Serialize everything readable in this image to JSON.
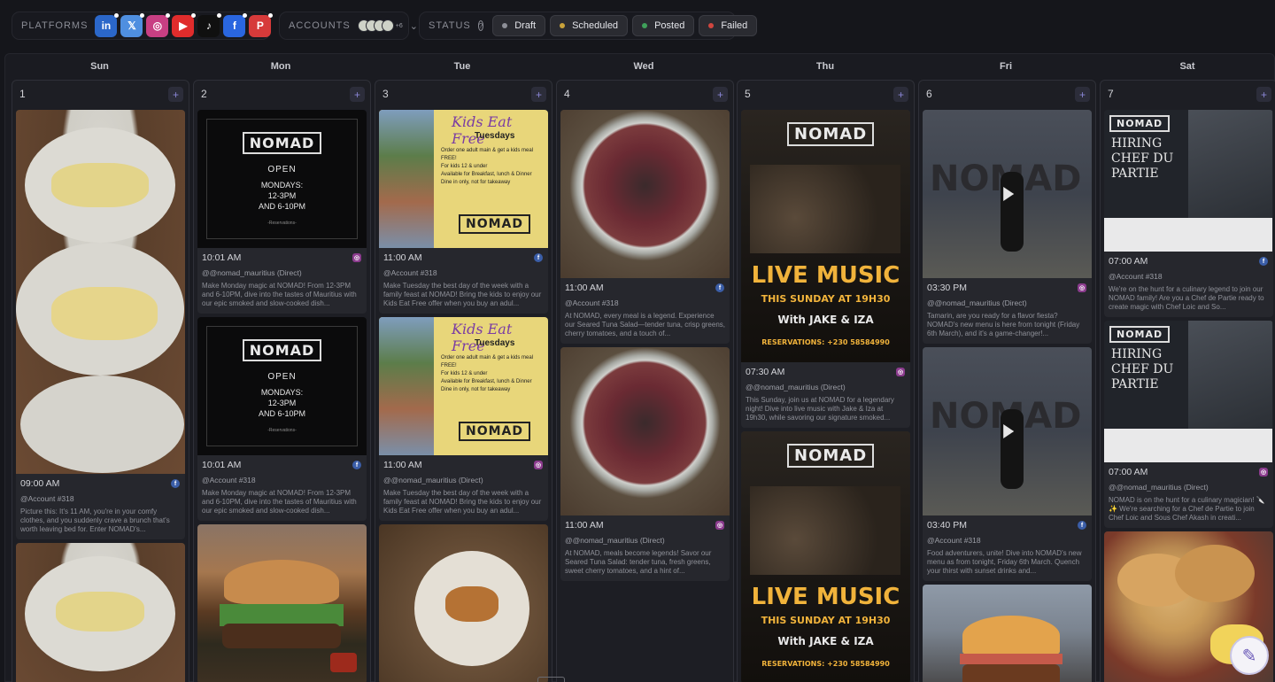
{
  "filters": {
    "platforms_label": "PLATFORMS",
    "platforms": [
      {
        "name": "linkedin",
        "icon": "linkedin-icon",
        "glyph": "in",
        "color": "#2b67c9"
      },
      {
        "name": "x",
        "icon": "x-icon",
        "glyph": "𝕏",
        "color": "#4f8fe0"
      },
      {
        "name": "instagram",
        "icon": "instagram-icon",
        "glyph": "◎",
        "color": "#c83f83"
      },
      {
        "name": "youtube",
        "icon": "youtube-icon",
        "glyph": "▶",
        "color": "#e02c2c"
      },
      {
        "name": "tiktok",
        "icon": "tiktok-icon",
        "glyph": "♪",
        "color": "#101010"
      },
      {
        "name": "facebook",
        "icon": "facebook-icon",
        "glyph": "f",
        "color": "#2a66e0"
      },
      {
        "name": "pinterest",
        "icon": "pinterest-icon",
        "glyph": "P",
        "color": "#d63a3a"
      }
    ],
    "accounts_label": "ACCOUNTS",
    "accounts_more": "+6",
    "status_label": "STATUS",
    "statuses": [
      {
        "label": "Draft",
        "color": "#8d8f97"
      },
      {
        "label": "Scheduled",
        "color": "#c9a23a"
      },
      {
        "label": "Posted",
        "color": "#3fa05a"
      },
      {
        "label": "Failed",
        "color": "#d0463f"
      }
    ]
  },
  "days": [
    {
      "name": "Sun",
      "num": "1"
    },
    {
      "name": "Mon",
      "num": "2"
    },
    {
      "name": "Tue",
      "num": "3"
    },
    {
      "name": "Wed",
      "num": "4"
    },
    {
      "name": "Thu",
      "num": "5"
    },
    {
      "name": "Fri",
      "num": "6"
    },
    {
      "name": "Sat",
      "num": "7"
    }
  ],
  "posts": {
    "sun_1": {
      "time": "09:00 AM",
      "network": "facebook",
      "account": "@Account #318",
      "caption": "Picture this: It's 11 AM, you're in your comfy clothes, and you suddenly crave a brunch that's worth leaving bed for. Enter NOMAD's..."
    },
    "mon_1": {
      "time": "10:01 AM",
      "network": "instagram",
      "account": "@@nomad_mauritius (Direct)",
      "caption": "Make Monday magic at NOMAD! From 12-3PM and 6-10PM, dive into the tastes of Mauritius with our epic smoked and slow-cooked dish..."
    },
    "mon_2": {
      "time": "10:01 AM",
      "network": "facebook",
      "account": "@Account #318",
      "caption": "Make Monday magic at NOMAD! From 12-3PM and 6-10PM, dive into the tastes of Mauritius with our epic smoked and slow-cooked dish..."
    },
    "tue_1": {
      "time": "11:00 AM",
      "network": "facebook",
      "account": "@Account #318",
      "caption": "Make Tuesday the best day of the week with a family feast at NOMAD! Bring the kids to enjoy our Kids Eat Free offer when you buy an adul..."
    },
    "tue_2": {
      "time": "11:00 AM",
      "network": "instagram",
      "account": "@@nomad_mauritius (Direct)",
      "caption": "Make Tuesday the best day of the week with a family feast at NOMAD! Bring the kids to enjoy our Kids Eat Free offer when you buy an adul..."
    },
    "wed_1": {
      "time": "11:00 AM",
      "network": "facebook",
      "account": "@Account #318",
      "caption": "At NOMAD, every meal is a legend. Experience our Seared Tuna Salad—tender tuna, crisp greens, cherry tomatoes, and a touch of..."
    },
    "wed_2": {
      "time": "11:00 AM",
      "network": "instagram",
      "account": "@@nomad_mauritius (Direct)",
      "caption": "At NOMAD, meals become legends! Savor our Seared Tuna Salad: tender tuna, fresh greens, sweet cherry tomatoes, and a hint of..."
    },
    "thu_1": {
      "time": "07:30 AM",
      "network": "instagram",
      "account": "@@nomad_mauritius (Direct)",
      "caption": "This Sunday, join us at NOMAD for a legendary night! Dive into live music with Jake & Iza at 19h30, while savoring our signature smoked..."
    },
    "fri_1": {
      "time": "03:30 PM",
      "network": "instagram",
      "account": "@@nomad_mauritius (Direct)",
      "caption": "Tamarin, are you ready for a flavor fiesta? NOMAD's new menu is here from tonight (Friday 6th March), and it's a game-changer!..."
    },
    "fri_2": {
      "time": "03:40 PM",
      "network": "facebook",
      "account": "@Account #318",
      "caption": "Food adventurers, unite! Dive into NOMAD's new menu as from tonight, Friday 6th March. Quench your thirst with sunset drinks and..."
    },
    "sat_1": {
      "time": "07:00 AM",
      "network": "facebook",
      "account": "@Account #318",
      "caption": "We're on the hunt for a culinary legend to join our NOMAD family! Are you a Chef de Partie ready to create magic with Chef Loic and So..."
    },
    "sat_2": {
      "time": "07:00 AM",
      "network": "instagram",
      "account": "@@nomad_mauritius (Direct)",
      "caption": "NOMAD is on the hunt for a culinary magician! 🔪✨ We're searching for a Chef de Partie to join Chef Loic and Sous Chef Akash in creati..."
    }
  },
  "creatives": {
    "nomad_logo": "NOMAD",
    "open": "OPEN",
    "hours": [
      "MONDAYS:",
      "12-3PM",
      "AND 6-10PM"
    ],
    "reservations": "-Reservations-",
    "kids_title": "Kids Eat Free",
    "kids_sub": "Tuesdays",
    "kids_bullets": [
      "Order one adult main & get a kids meal FREE!",
      "For kids 12 & under",
      "Available for Breakfast, lunch & Dinner",
      "Dine in only, not for takeaway"
    ],
    "live_title": "LIVE MUSIC",
    "live_sub": "THIS SUNDAY AT 19H30",
    "live_with": "With JAKE & IZA",
    "live_res": "RESERVATIONS: +230 58584990",
    "hiring": [
      "HIRING",
      "CHEF DU",
      "PARTIE"
    ]
  }
}
